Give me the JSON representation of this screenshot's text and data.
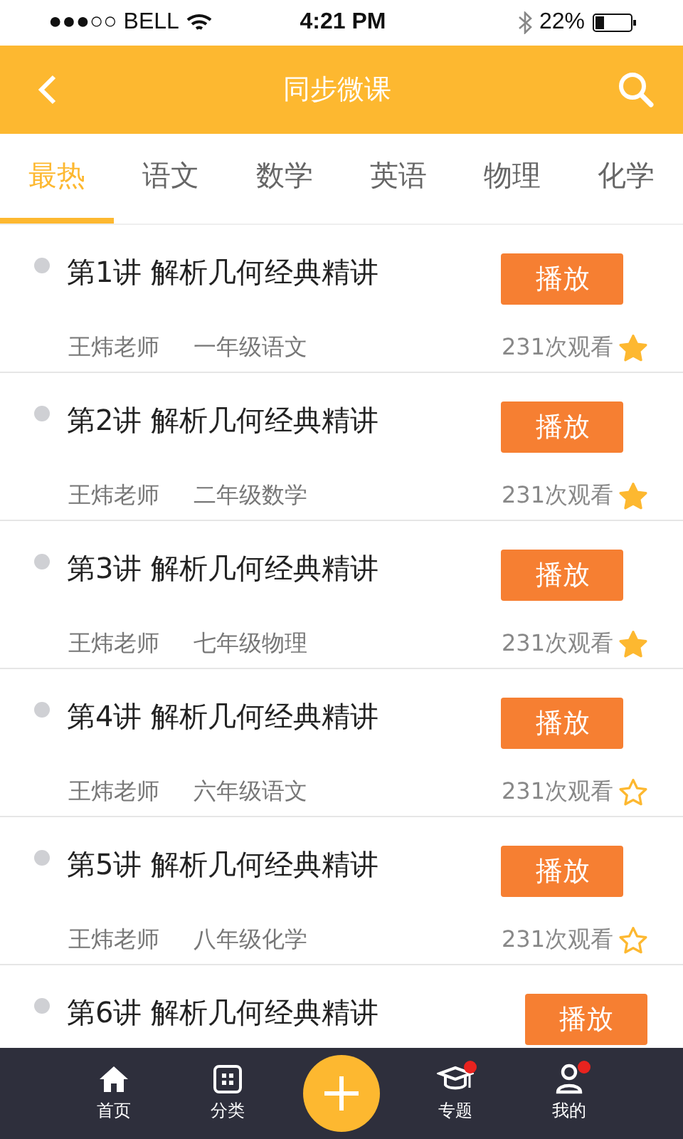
{
  "status_bar": {
    "carrier": "●●●○○ BELL",
    "time": "4:21 PM",
    "battery": "22%"
  },
  "header": {
    "title": "同步微课"
  },
  "tabs": [
    {
      "label": "最热",
      "selected": true
    },
    {
      "label": "语文",
      "selected": false
    },
    {
      "label": "数学",
      "selected": false
    },
    {
      "label": "英语",
      "selected": false
    },
    {
      "label": "物理",
      "selected": false
    },
    {
      "label": "化学",
      "selected": false
    }
  ],
  "lessons": [
    {
      "title": "第1讲  解析几何经典精讲",
      "teacher": "王炜老师",
      "grade": "一年级语文",
      "views": "231次观看",
      "button": "播放",
      "starred": true
    },
    {
      "title": "第2讲  解析几何经典精讲",
      "teacher": "王炜老师",
      "grade": "二年级数学",
      "views": "231次观看",
      "button": "播放",
      "starred": true
    },
    {
      "title": "第3讲  解析几何经典精讲",
      "teacher": "王炜老师",
      "grade": "七年级物理",
      "views": "231次观看",
      "button": "播放",
      "starred": true
    },
    {
      "title": "第4讲  解析几何经典精讲",
      "teacher": "王炜老师",
      "grade": "六年级语文",
      "views": "231次观看",
      "button": "播放",
      "starred": false
    },
    {
      "title": "第5讲  解析几何经典精讲",
      "teacher": "王炜老师",
      "grade": "八年级化学",
      "views": "231次观看",
      "button": "播放",
      "starred": false
    },
    {
      "title": "第6讲  解析几何经典精讲",
      "button": "播放"
    }
  ],
  "tab_bar": [
    {
      "kind": "home",
      "label": "首页",
      "badge": false
    },
    {
      "kind": "grid",
      "label": "分类",
      "badge": false
    },
    {
      "kind": "add"
    },
    {
      "kind": "cap",
      "label": "专题",
      "badge": true
    },
    {
      "kind": "user",
      "label": "我的",
      "badge": true
    }
  ]
}
